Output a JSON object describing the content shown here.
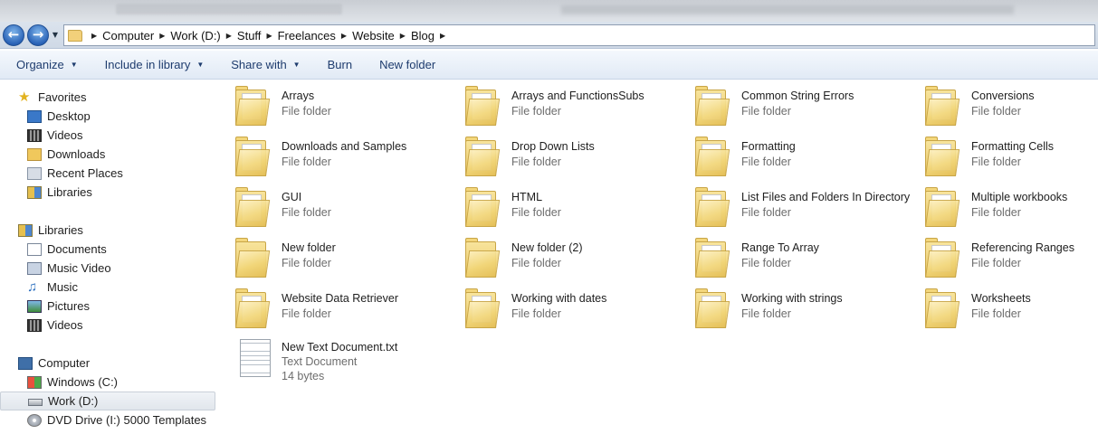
{
  "breadcrumb": [
    "Computer",
    "Work (D:)",
    "Stuff",
    "Freelances",
    "Website",
    "Blog"
  ],
  "toolbar": {
    "organize": "Organize",
    "include_in_library": "Include in library",
    "share_with": "Share with",
    "burn": "Burn",
    "new_folder": "New folder"
  },
  "nav": {
    "favorites": "Favorites",
    "desktop": "Desktop",
    "videos": "Videos",
    "downloads": "Downloads",
    "recent_places": "Recent Places",
    "libraries_fav": "Libraries",
    "libraries": "Libraries",
    "documents": "Documents",
    "music_video": "Music Video",
    "music": "Music",
    "pictures": "Pictures",
    "lib_videos": "Videos",
    "computer": "Computer",
    "windows_c": "Windows (C:)",
    "work_d": "Work (D:)",
    "dvd_drive": "DVD Drive (I:) 5000 Templates"
  },
  "items": [
    {
      "name": "Arrays",
      "type": "File folder"
    },
    {
      "name": "Arrays and FunctionsSubs",
      "type": "File folder"
    },
    {
      "name": "Common String Errors",
      "type": "File folder"
    },
    {
      "name": "Conversions",
      "type": "File folder"
    },
    {
      "name": "Downloads and Samples",
      "type": "File folder"
    },
    {
      "name": "Drop Down Lists",
      "type": "File folder"
    },
    {
      "name": "Formatting",
      "type": "File folder"
    },
    {
      "name": "Formatting Cells",
      "type": "File folder"
    },
    {
      "name": "GUI",
      "type": "File folder"
    },
    {
      "name": "HTML",
      "type": "File folder"
    },
    {
      "name": "List Files and Folders In Directory",
      "type": "File folder"
    },
    {
      "name": "Multiple workbooks",
      "type": "File folder"
    },
    {
      "name": "New folder",
      "type": "File folder"
    },
    {
      "name": "New folder (2)",
      "type": "File folder"
    },
    {
      "name": "Range To Array",
      "type": "File folder"
    },
    {
      "name": "Referencing Ranges",
      "type": "File folder"
    },
    {
      "name": "Website Data Retriever",
      "type": "File folder"
    },
    {
      "name": "Working with dates",
      "type": "File folder"
    },
    {
      "name": "Working with strings",
      "type": "File folder"
    },
    {
      "name": "Worksheets",
      "type": "File folder"
    },
    {
      "name": "New Text Document.txt",
      "type": "Text Document",
      "size": "14 bytes"
    }
  ]
}
